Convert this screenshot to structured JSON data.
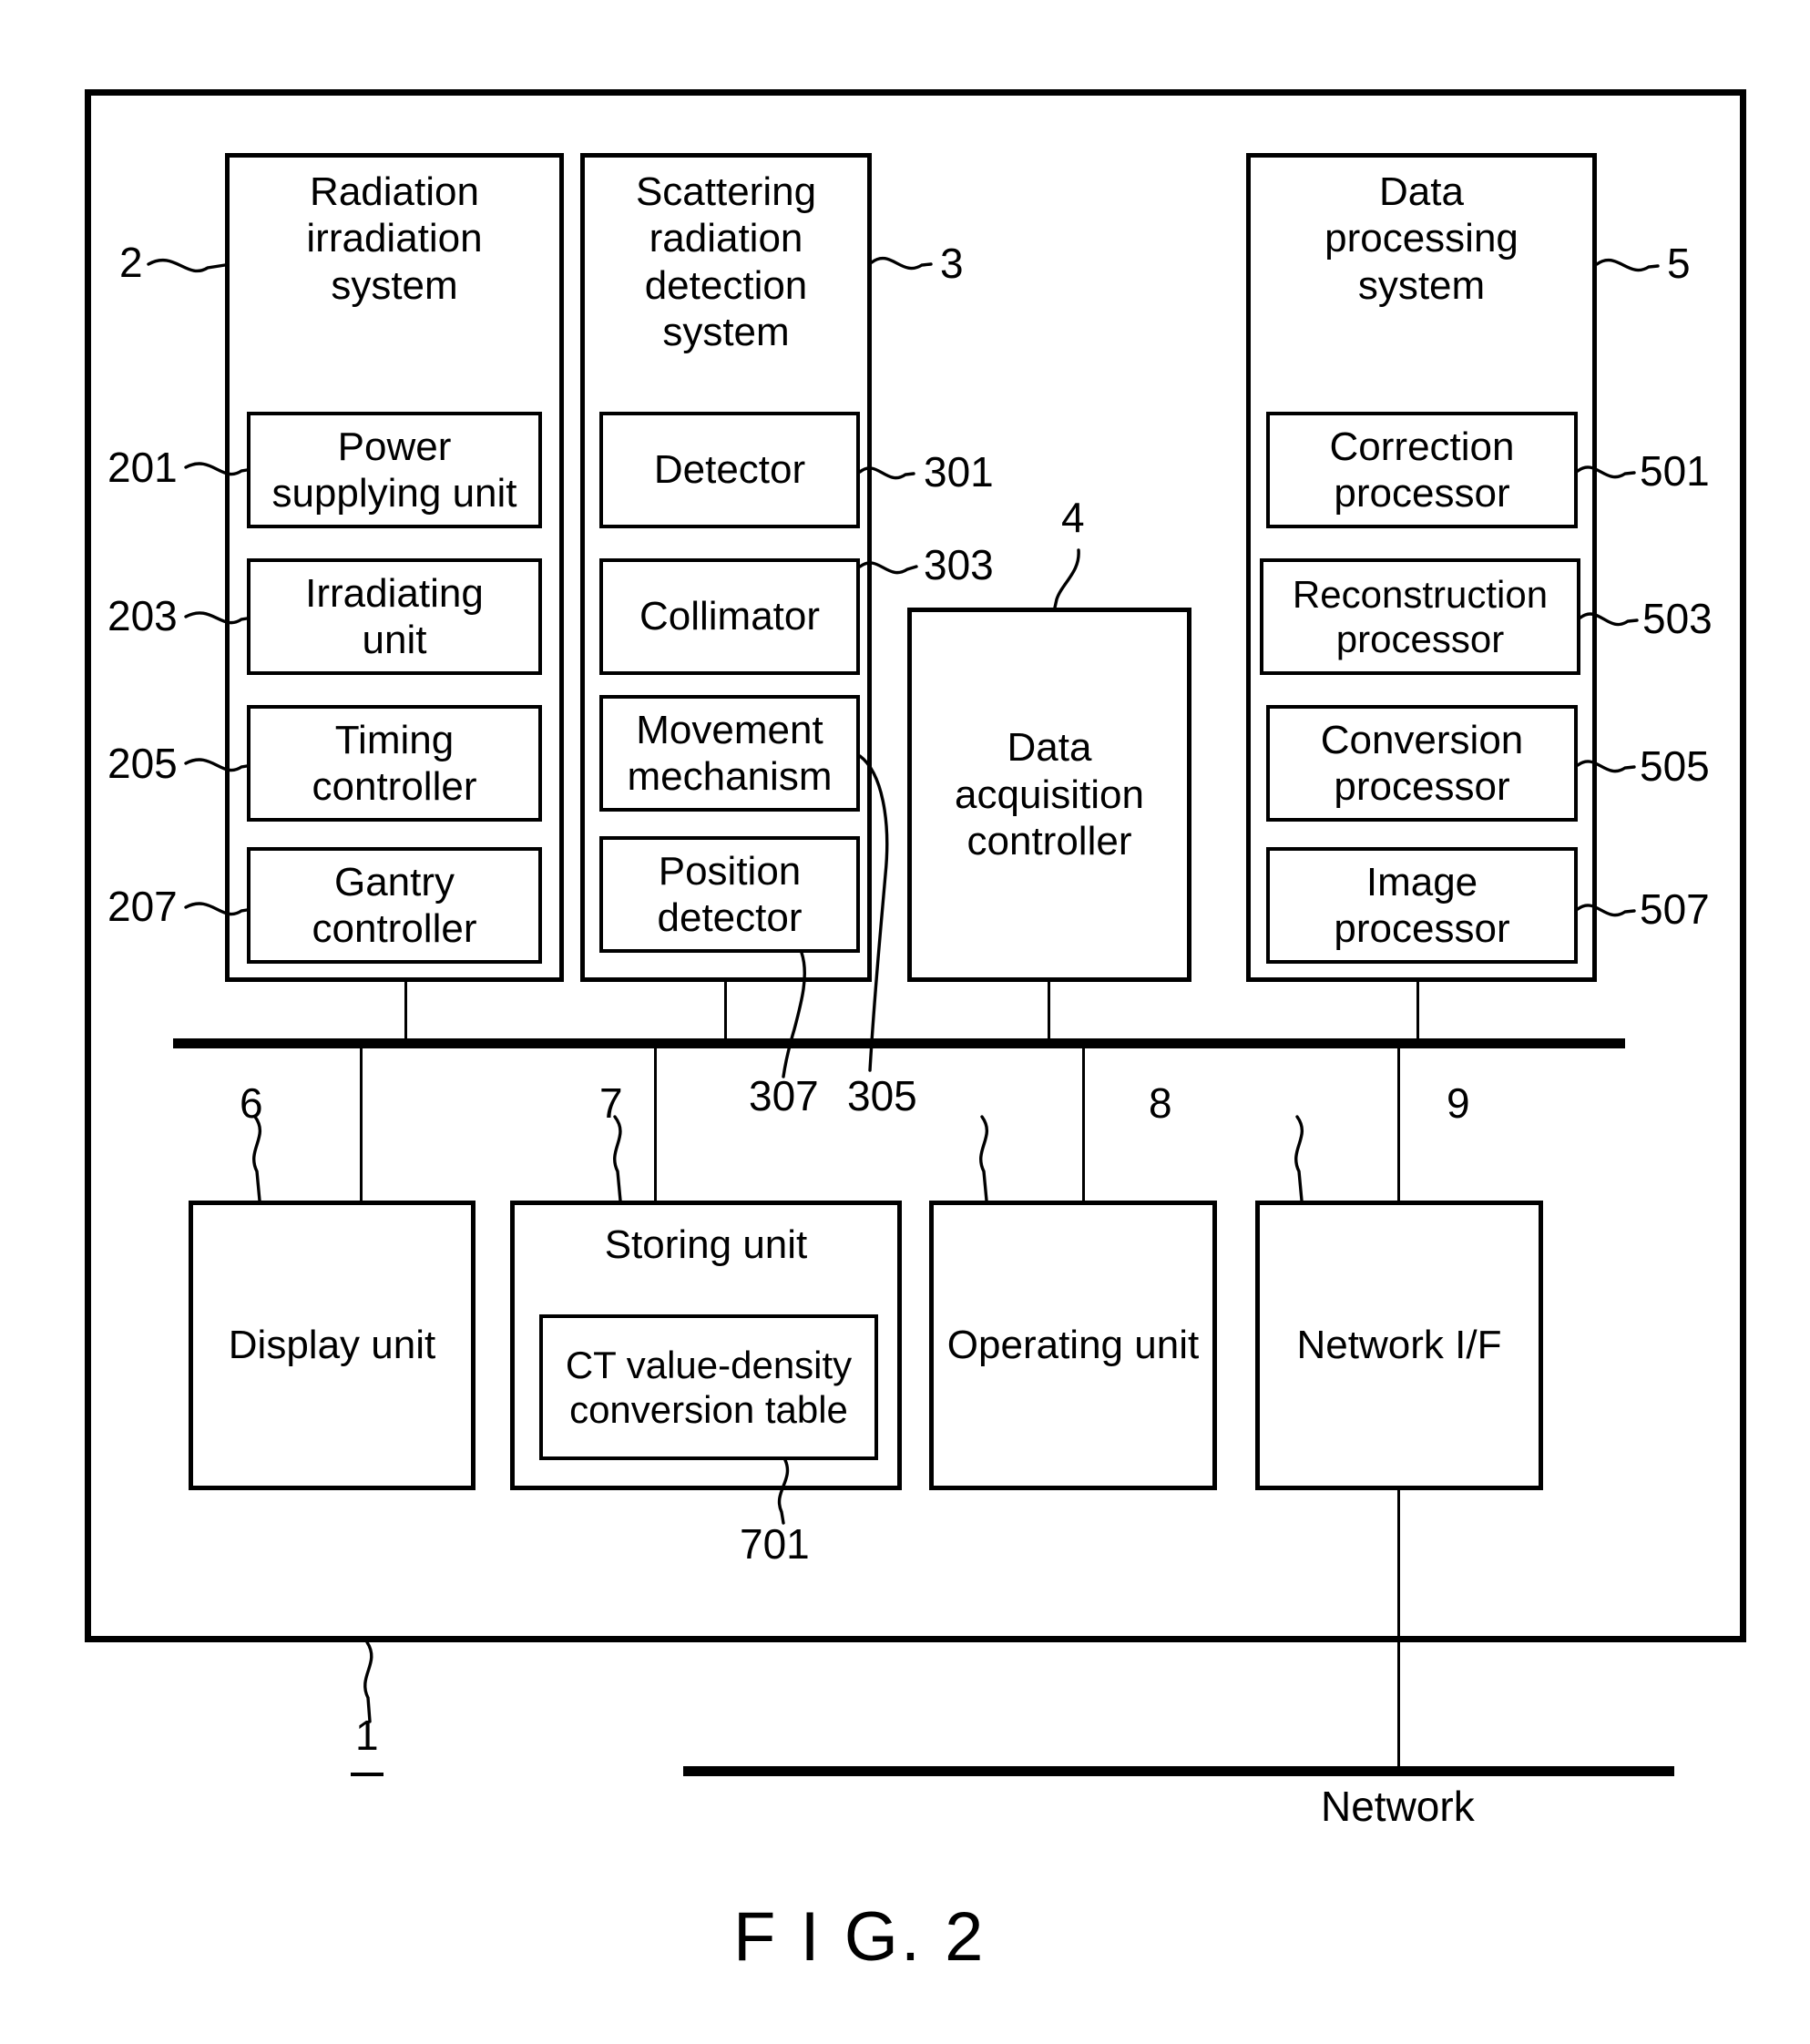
{
  "figure": {
    "caption": "F I G. 2",
    "outer_ref": "1",
    "network_label": "Network"
  },
  "systems": [
    {
      "ref": "2",
      "title": "Radiation\nirradiation\nsystem",
      "modules": [
        {
          "ref": "201",
          "label": "Power\nsupplying unit"
        },
        {
          "ref": "203",
          "label": "Irradiating\nunit"
        },
        {
          "ref": "205",
          "label": "Timing\ncontroller"
        },
        {
          "ref": "207",
          "label": "Gantry\ncontroller"
        }
      ]
    },
    {
      "ref": "3",
      "title": "Scattering\nradiation\ndetection\nsystem",
      "modules": [
        {
          "ref": "301",
          "label": "Detector"
        },
        {
          "ref": "303",
          "label": "Collimator"
        },
        {
          "ref": "305",
          "label": "Movement\nmechanism"
        },
        {
          "ref": "307",
          "label": "Position\ndetector"
        }
      ]
    },
    {
      "ref": "5",
      "title": "Data\nprocessing\nsystem",
      "modules": [
        {
          "ref": "501",
          "label": "Correction\nprocessor"
        },
        {
          "ref": "503",
          "label": "Reconstruction\nprocessor"
        },
        {
          "ref": "505",
          "label": "Conversion\nprocessor"
        },
        {
          "ref": "507",
          "label": "Image\nprocessor"
        }
      ]
    }
  ],
  "standalone": {
    "acquisition": {
      "ref": "4",
      "label": "Data\nacquisition\ncontroller"
    }
  },
  "peripherals": [
    {
      "ref": "6",
      "label": "Display unit"
    },
    {
      "ref": "7",
      "label": "Storing unit"
    },
    {
      "ref": "8",
      "label": "Operating unit"
    },
    {
      "ref": "9",
      "label": "Network I/F"
    }
  ],
  "storing_inner": {
    "ref": "701",
    "label": "CT value-density\nconversion table"
  },
  "colors": {
    "ink": "#000000",
    "paper": "#ffffff"
  }
}
